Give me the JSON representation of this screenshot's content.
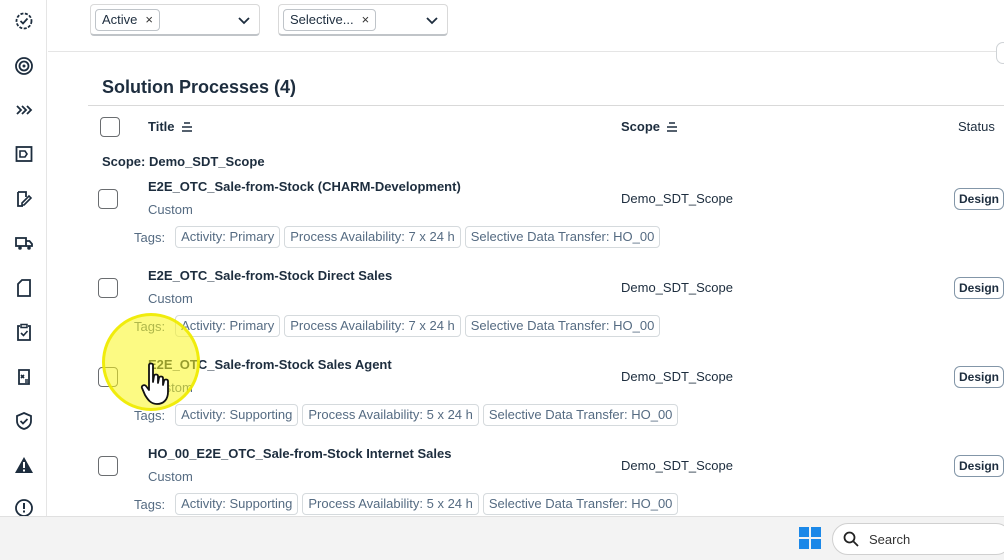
{
  "filters": [
    {
      "token": "Active",
      "remove": "×"
    },
    {
      "token": "Selective...",
      "remove": "×"
    }
  ],
  "panel": {
    "title": "Solution Processes (4)"
  },
  "columns": {
    "title": "Title",
    "scope": "Scope",
    "status": "Status"
  },
  "group_header": "Scope: Demo_SDT_Scope",
  "tags_label": "Tags:",
  "rows": [
    {
      "title": "E2E_OTC_Sale-from-Stock (CHARM-Development)",
      "type": "Custom",
      "scope": "Demo_SDT_Scope",
      "status": "Design",
      "tags": [
        "Activity: Primary",
        "Process Availability: 7 x 24 h",
        "Selective Data Transfer: HO_00"
      ]
    },
    {
      "title": "E2E_OTC_Sale-from-Stock Direct Sales",
      "type": "Custom",
      "scope": "Demo_SDT_Scope",
      "status": "Design",
      "tags": [
        "Activity: Primary",
        "Process Availability: 7 x 24 h",
        "Selective Data Transfer: HO_00"
      ]
    },
    {
      "title": "E2E_OTC_Sale-from-Stock Sales Agent",
      "type": "Custom",
      "scope": "Demo_SDT_Scope",
      "status": "Design",
      "tags": [
        "Activity: Supporting",
        "Process Availability: 5 x 24 h",
        "Selective Data Transfer: HO_00"
      ]
    },
    {
      "title": "HO_00_E2E_OTC_Sale-from-Stock Internet Sales",
      "type": "Custom",
      "scope": "Demo_SDT_Scope",
      "status": "Design",
      "tags": [
        "Activity: Supporting",
        "Process Availability: 5 x 24 h",
        "Selective Data Transfer: HO_00"
      ]
    }
  ],
  "rail_icons": [
    "settings-check-icon",
    "target-icon",
    "chevrons-right-icon",
    "process-icon",
    "edit-doc-icon",
    "truck-icon",
    "document-icon",
    "clipboard-check-icon",
    "test-icon",
    "shield-check-icon",
    "alert-icon",
    "help-icon"
  ],
  "taskbar": {
    "search_label": "Search"
  }
}
